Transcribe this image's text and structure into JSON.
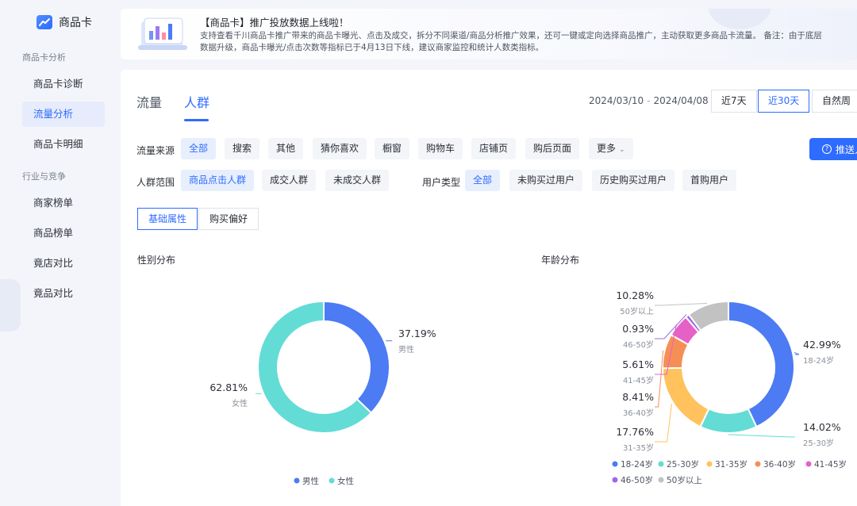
{
  "sidebar": {
    "brand": "商品卡",
    "groups": [
      "商品卡分析",
      "行业与竞争"
    ],
    "items": [
      {
        "label": "商品卡诊断"
      },
      {
        "label": "流量分析",
        "active": true
      },
      {
        "label": "商品卡明细"
      },
      {
        "label": "商家榜单"
      },
      {
        "label": "商品榜单"
      },
      {
        "label": "竟店对比"
      },
      {
        "label": "竟品对比"
      }
    ]
  },
  "banner": {
    "title": "【商品卡】推广投放数据上线啦！",
    "text": "支持查看千川商品卡推广带来的商品卡曝光、点击及成交，拆分不同渠道/商品分析推广效果，还可一键或定向选择商品推广，主动获取更多商品卡流量。 备注：由于底层数据升级，商品卡曝光/点击次数等指标已于4月13日下线，建议商家监控和统计人数类指标。"
  },
  "tabs": [
    {
      "label": "流量"
    },
    {
      "label": "人群",
      "active": true
    }
  ],
  "date": {
    "start": "2024/03/10",
    "sep": "-",
    "end": "2024/04/08",
    "ranges": [
      {
        "label": "近7天"
      },
      {
        "label": "近30天",
        "active": true
      },
      {
        "label": "自然周"
      }
    ]
  },
  "filters": {
    "source_label": "流量来源",
    "sources": [
      "全部",
      "搜索",
      "其他",
      "猜你喜欢",
      "橱窗",
      "购物车",
      "店铺页",
      "购后页面",
      "更多"
    ],
    "crowd_label": "人群范围",
    "crowds": [
      "商品点击人群",
      "成交人群",
      "未成交人群"
    ],
    "user_label": "用户类型",
    "users": [
      "全部",
      "未购买过用户",
      "历史购买过用户",
      "首购用户"
    ]
  },
  "push_button": "推送人",
  "subtabs": [
    {
      "label": "基础属性",
      "active": true
    },
    {
      "label": "购买偏好"
    }
  ],
  "chart_data": [
    {
      "type": "pie",
      "title": "性别分布",
      "categories": [
        "男性",
        "女性"
      ],
      "values": [
        37.19,
        62.81
      ],
      "value_labels": [
        "37.19%",
        "62.81%"
      ],
      "colors": [
        "#4c7bf3",
        "#62dcd5"
      ],
      "legend": "bottom"
    },
    {
      "type": "pie",
      "title": "年龄分布",
      "categories": [
        "18-24岁",
        "25-30岁",
        "31-35岁",
        "36-40岁",
        "41-45岁",
        "46-50岁",
        "50岁以上"
      ],
      "values": [
        42.99,
        14.02,
        17.76,
        8.41,
        5.61,
        0.93,
        10.28
      ],
      "value_labels": [
        "42.99%",
        "14.02%",
        "17.76%",
        "8.41%",
        "5.61%",
        "0.93%",
        "10.28%"
      ],
      "colors": [
        "#4c7bf3",
        "#62dcd5",
        "#ffc25c",
        "#f58f56",
        "#e661c6",
        "#9b6be3",
        "#c2c2c2"
      ],
      "legend": "bottom"
    }
  ]
}
